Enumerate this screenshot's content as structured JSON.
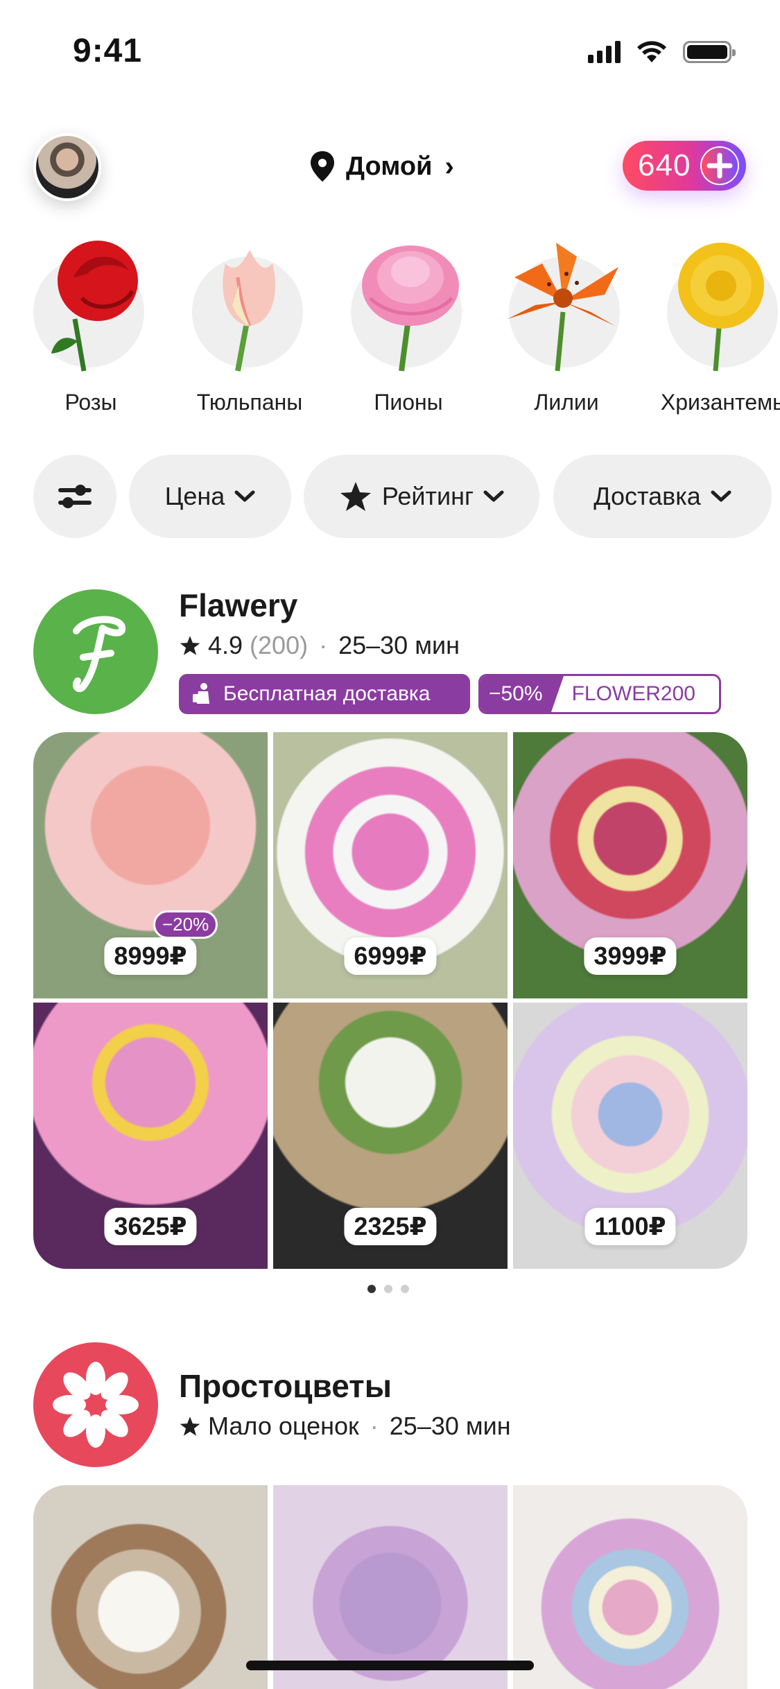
{
  "status_bar": {
    "time": "9:41"
  },
  "header": {
    "location_label": "Домой",
    "points_value": "640"
  },
  "categories": [
    {
      "label": "Розы",
      "color": "#d6141c",
      "icon": "rose-icon"
    },
    {
      "label": "Тюльпаны",
      "color": "#f4b9b2",
      "icon": "tulip-icon"
    },
    {
      "label": "Пионы",
      "color": "#f18cb8",
      "icon": "peony-icon"
    },
    {
      "label": "Лилии",
      "color": "#f26a17",
      "icon": "lily-icon"
    },
    {
      "label": "Хризантемы",
      "color": "#f2c21a",
      "icon": "chrysanthemum-icon"
    }
  ],
  "filters": {
    "settings_icon": "sliders-icon",
    "price_label": "Цена",
    "rating_label": "Рейтинг",
    "delivery_label": "Доставка"
  },
  "stores": [
    {
      "name": "Flawery",
      "logo_letter": "F",
      "logo_color": "#5ab24a",
      "rating": "4.9",
      "reviews": "(200)",
      "time": "25–30 мин",
      "badge_delivery": "Бесплатная доставка",
      "promo_discount": "−50%",
      "promo_code": "FLOWER200",
      "products": [
        {
          "price": "8999₽",
          "discount": "−20%",
          "color": "#f1a7a2"
        },
        {
          "price": "6999₽",
          "color": "#e77bbf"
        },
        {
          "price": "3999₽",
          "color": "#c2436a"
        },
        {
          "price": "3625₽",
          "color": "#e592c6"
        },
        {
          "price": "2325₽",
          "color": "#b8a27f"
        },
        {
          "price": "1100₽",
          "color": "#9fb7e2"
        }
      ],
      "pager": {
        "pages": 3,
        "active": 1
      }
    },
    {
      "name": "Простоцветы",
      "logo_color": "#e8485c",
      "rating_text": "Мало оценок",
      "time": "25–30 мин",
      "products": [
        {
          "color": "#d6cfc4"
        },
        {
          "color": "#b89ad0"
        },
        {
          "color": "#e7a9c8"
        }
      ]
    }
  ],
  "accent_color": "#8b3ca0"
}
